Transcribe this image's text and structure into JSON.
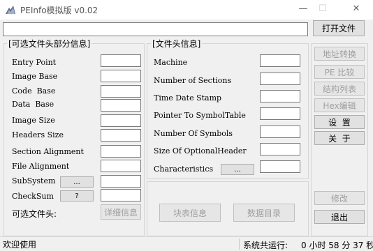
{
  "window": {
    "title": "PEInfo模拟版 v0.02",
    "controls": {
      "minimize": "—",
      "maximize": "☐",
      "close": "✕"
    }
  },
  "path_input": {
    "value": "",
    "placeholder": ""
  },
  "open_button": "打开文件",
  "optional_group": {
    "title": "[可选文件头部分信息]",
    "fields": [
      {
        "label": "Entry Point",
        "value": ""
      },
      {
        "label": "Image Base",
        "value": ""
      },
      {
        "label": "Code  Base",
        "value": ""
      },
      {
        "label": "Data  Base",
        "value": ""
      },
      {
        "label": "Image Size",
        "value": ""
      },
      {
        "label": "Headers Size",
        "value": ""
      },
      {
        "label": "Section Alignment",
        "value": ""
      },
      {
        "label": "File Alignment",
        "value": ""
      },
      {
        "label": "SubSystem",
        "value": "",
        "button": "..."
      },
      {
        "label": "CheckSum",
        "value": "",
        "button": "?"
      }
    ],
    "optional_header_label": "可选文件头:",
    "details_button": "详细信息"
  },
  "file_header_group": {
    "title": "[文件头信息]",
    "fields": [
      {
        "label": "Machine",
        "value": ""
      },
      {
        "label": "Number of Sections",
        "value": ""
      },
      {
        "label": "Time Date Stamp",
        "value": ""
      },
      {
        "label": "Pointer To SymbolTable",
        "value": ""
      },
      {
        "label": "Number Of Symbols",
        "value": ""
      },
      {
        "label": "Size Of OptionalHeader",
        "value": ""
      },
      {
        "label": "Characteristics",
        "value": "",
        "button": "..."
      }
    ]
  },
  "bottom_panel": {
    "block_table_button": "块表信息",
    "data_directory_button": "数据目录"
  },
  "side_buttons": {
    "address_convert": "地址转换",
    "pe_compare": "PE 比较",
    "struct_list": "结构列表",
    "hex_editor": "Hex编辑",
    "settings": "设  置",
    "about": "关  于",
    "modify": "修改",
    "exit": "退出"
  },
  "status": {
    "message": "欢迎使用",
    "runtime_label": "系统共运行:",
    "runtime_value": "0 小时 58 分 37 秒"
  }
}
